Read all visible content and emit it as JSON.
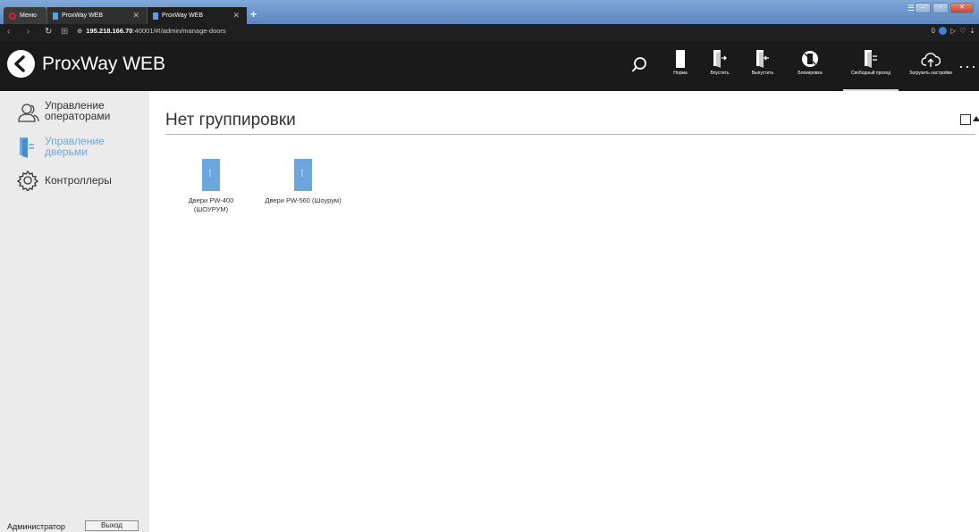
{
  "browser": {
    "menu_label": "Меню",
    "tabs": [
      {
        "title": "ProxWay WEB"
      },
      {
        "title": "ProxWay WEB"
      }
    ],
    "address": {
      "host": "195.218.166.70",
      "path": ":40001/#!/admin/manage-doors"
    },
    "vpn_count": "0"
  },
  "header": {
    "title": "ProxWay WEB",
    "buttons": [
      {
        "label": "Норма"
      },
      {
        "label": "Впустить"
      },
      {
        "label": "Выпустить"
      },
      {
        "label": "Блокировка"
      },
      {
        "label": "Свободный проход"
      },
      {
        "label": "Загрузить настройки"
      }
    ],
    "more": "···"
  },
  "sidebar": {
    "items": [
      {
        "label": "Управление операторами",
        "icon": "operators-icon"
      },
      {
        "label": "Управление дверьми",
        "icon": "door-icon"
      },
      {
        "label": "Контроллеры",
        "icon": "gear-icon"
      }
    ],
    "user": "Администратор",
    "logout": "Выход"
  },
  "main": {
    "group_title": "Нет группировки",
    "doors": [
      {
        "label": "Двери PW-400 (ШОУРУМ)"
      },
      {
        "label": "Двери PW-560 (Шоурум)"
      }
    ]
  },
  "colors": {
    "accent": "#6ea8dd",
    "header_bg": "#1a1a1a",
    "sidebar_bg": "#ebebeb"
  }
}
